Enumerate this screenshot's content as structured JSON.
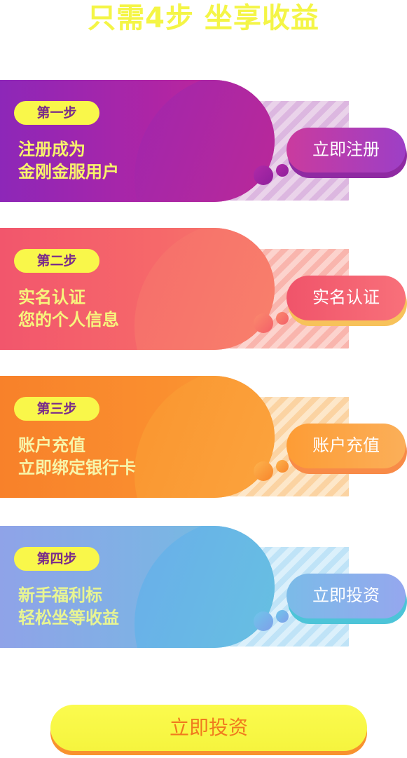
{
  "headline": "只需4步  坐享收益",
  "steps": [
    {
      "badge": "第一步",
      "line1": "注册成为",
      "line2": "金刚金服用户",
      "button": "立即注册"
    },
    {
      "badge": "第二步",
      "line1": "实名认证",
      "line2": "您的个人信息",
      "button": "实名认证"
    },
    {
      "badge": "第三步",
      "line1": "账户充值",
      "line2": "立即绑定银行卡",
      "button": "账户充值"
    },
    {
      "badge": "第四步",
      "line1": "新手福利标",
      "line2": "轻松坐等收益",
      "button": "立即投资"
    }
  ],
  "invest_button": "立即投资",
  "colors": {
    "headline": "#f4f546",
    "badge_bg": "#f9f74a",
    "step1": "#9a26b0",
    "step2": "#f4606a",
    "step3": "#f98a2d",
    "step4": "#7fb4e6",
    "invest_bg": "#f7f646",
    "invest_text": "#f07a1e"
  }
}
